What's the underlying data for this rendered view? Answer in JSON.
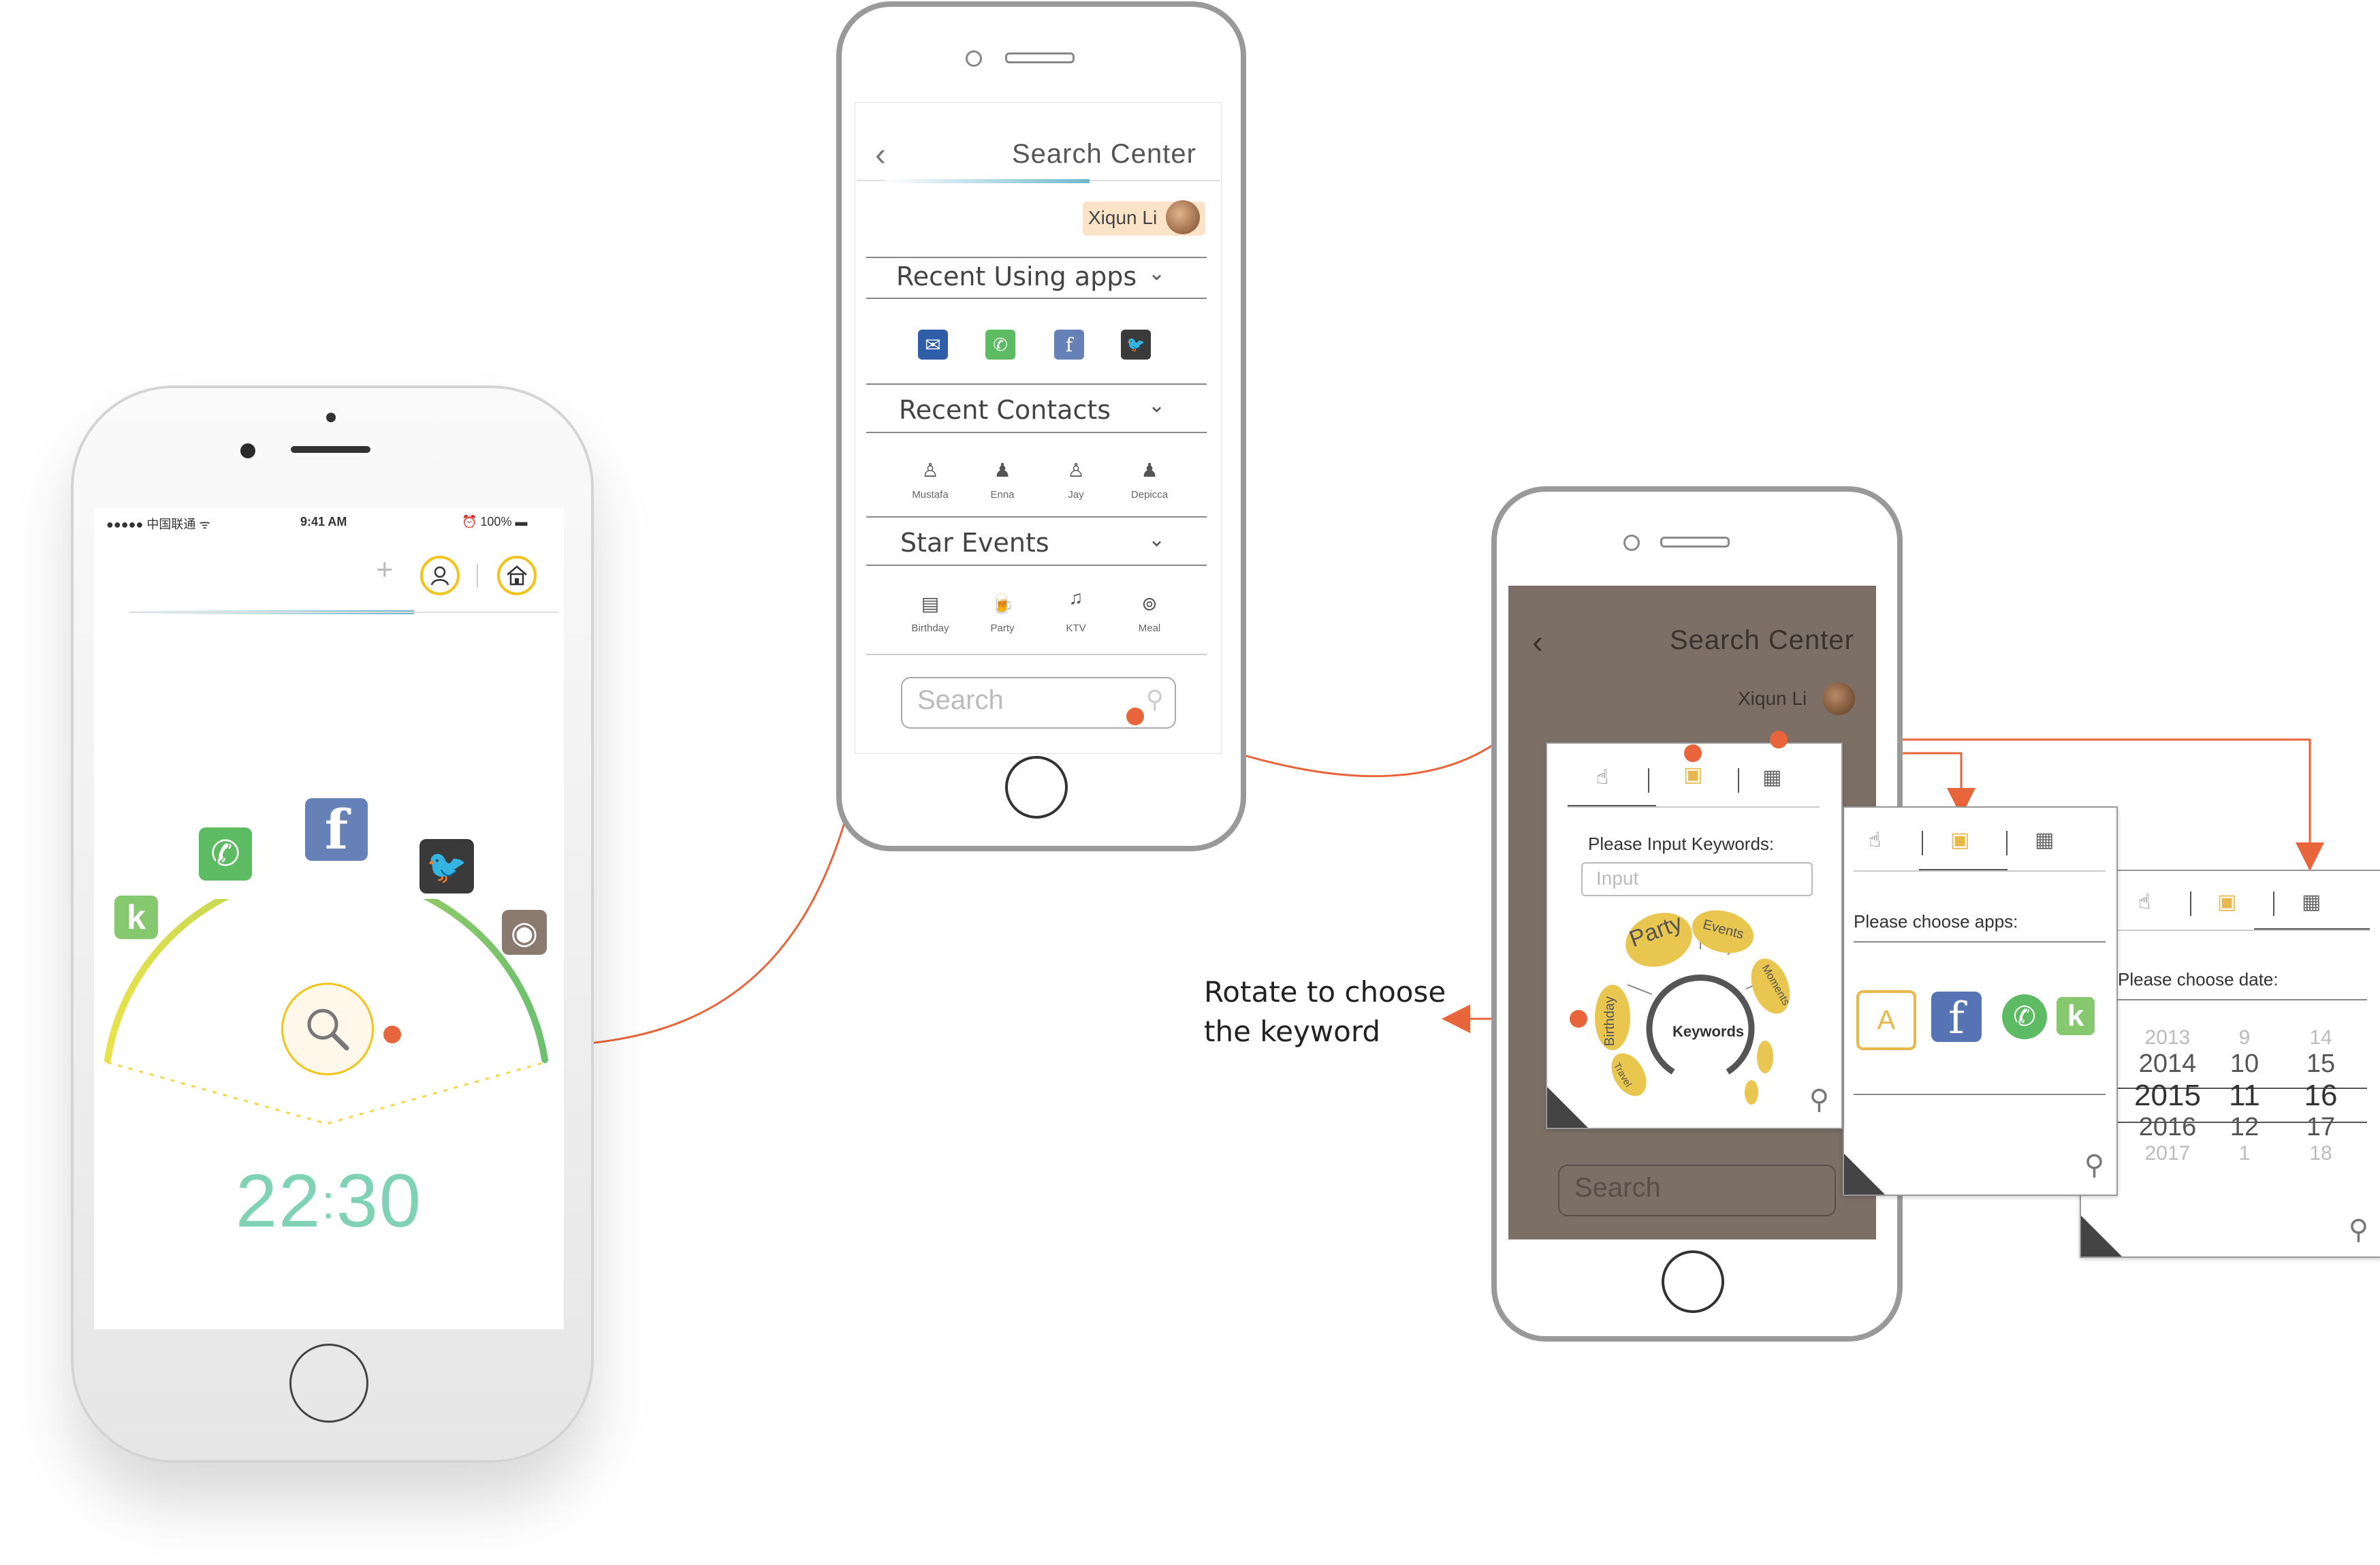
{
  "phone1": {
    "status": {
      "carrier": "●●●●● 中国联通 ᯤ",
      "time": "9:41 AM",
      "battery": "⏰ 100% ▬"
    },
    "clock": {
      "hours": "22",
      "sep": ":",
      "minutes": "30"
    },
    "plus": "+",
    "apps": [
      {
        "name": "whatsapp-app-icon",
        "glyph": "✆",
        "color": "#5dbb63"
      },
      {
        "name": "facebook-app-icon",
        "glyph": "f",
        "color": "#6680b8"
      },
      {
        "name": "twitter-app-icon",
        "glyph": "🐦",
        "color": "#3a3a3a"
      },
      {
        "name": "kik-app-icon",
        "glyph": "k",
        "color": "#85c86e"
      },
      {
        "name": "instagram-app-icon",
        "glyph": "◉",
        "color": "#8a7a70"
      }
    ]
  },
  "phone2": {
    "title": "Search Center",
    "back": "‹",
    "user": "Xiqun Li",
    "sections": {
      "recent_apps": "Recent Using apps",
      "recent_contacts": "Recent Contacts",
      "star_events": "Star Events"
    },
    "contacts": [
      "Mustafa",
      "Enna",
      "Jay",
      "Depicca"
    ],
    "events": [
      "Birthday",
      "Party",
      "KTV",
      "Meal"
    ],
    "search_placeholder": "Search"
  },
  "phone3": {
    "title": "Search Center",
    "user": "Xiqun Li",
    "search_placeholder": "Search",
    "card1": {
      "label": "Please Input Keywords:",
      "placeholder": "Input",
      "dial_center": "Keywords",
      "petals": [
        "Party",
        "Events",
        "Moments",
        "Birthday",
        "Travel"
      ]
    },
    "card2": {
      "label": "Please choose apps:"
    },
    "card3": {
      "label": "Please choose date:",
      "years": [
        "2013",
        "2014",
        "2015",
        "2016",
        "2017"
      ],
      "months": [
        "9",
        "10",
        "11",
        "12",
        "1"
      ],
      "days": [
        "14",
        "15",
        "16",
        "17",
        "18"
      ]
    }
  },
  "annotation": {
    "line1": "Rotate to choose",
    "line2": "the keyword"
  },
  "colors": {
    "accent": "#e8643a",
    "ring": "#f0c419",
    "clock": "#7fd3b4",
    "arc_start": "#e8e24a",
    "arc_end": "#6cc070"
  }
}
